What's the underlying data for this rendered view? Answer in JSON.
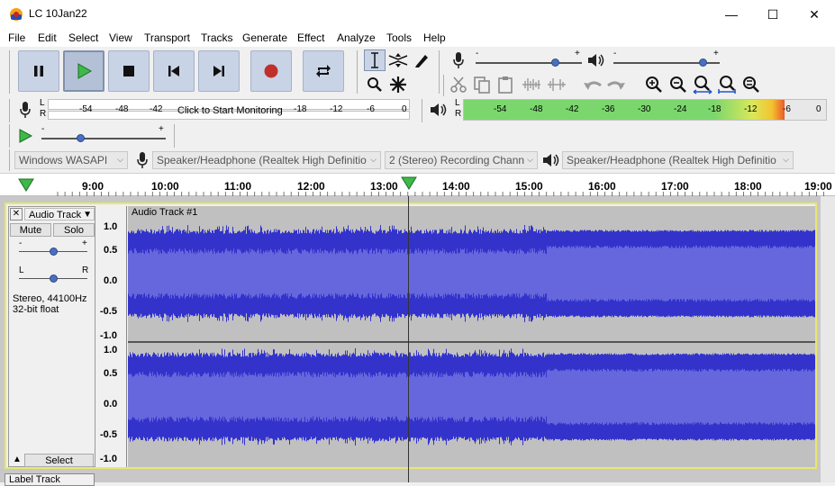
{
  "window": {
    "title": "LC 10Jan22",
    "minimize": "—",
    "maximize": "☐",
    "close": "✕"
  },
  "menu": [
    "File",
    "Edit",
    "Select",
    "View",
    "Transport",
    "Tracks",
    "Generate",
    "Effect",
    "Analyze",
    "Tools",
    "Help"
  ],
  "recording_meter": {
    "channels": [
      "L",
      "R"
    ],
    "ticks": [
      "-54",
      "-48",
      "-42",
      "-18",
      "-12",
      "-6",
      "0"
    ],
    "prompt": "Click to Start Monitoring"
  },
  "playback_meter": {
    "channels": [
      "L",
      "R"
    ],
    "ticks": [
      "-54",
      "-48",
      "-42",
      "-36",
      "-30",
      "-24",
      "-18",
      "-12",
      "-6",
      "0"
    ],
    "level_fraction": 0.885
  },
  "recording_volume": {
    "minus": "-",
    "plus": "+",
    "value": 0.75
  },
  "playback_volume": {
    "minus": "-",
    "plus": "+",
    "value": 0.85
  },
  "play_at_speed": {
    "minus": "-",
    "plus": "+",
    "value": 0.32
  },
  "device": {
    "host": "Windows WASAPI",
    "recording_device": "Speaker/Headphone (Realtek High Definitio",
    "channels": "2 (Stereo) Recording Chann",
    "playback_device": "Speaker/Headphone (Realtek High Definitio"
  },
  "timeline": {
    "labels": [
      "9:00",
      "10:00",
      "11:00",
      "12:00",
      "13:00",
      "14:00",
      "15:00",
      "16:00",
      "17:00",
      "18:00",
      "19:00"
    ]
  },
  "track": {
    "name": "Audio Track",
    "clip_name": "Audio Track #1",
    "mute": "Mute",
    "solo": "Solo",
    "gain_minus": "-",
    "gain_plus": "+",
    "pan_left": "L",
    "pan_right": "R",
    "format_line1": "Stereo, 44100Hz",
    "format_line2": "32-bit float",
    "select": "Select",
    "close": "✕",
    "scale_top": [
      "1.0",
      "0.5",
      "0.0",
      "-0.5",
      "-1.0"
    ],
    "scale_bottom": [
      "1.0",
      "0.5",
      "0.0",
      "-0.5",
      "-1.0"
    ]
  },
  "next_track": {
    "name": "Label Track"
  },
  "colors": {
    "wave_dark": "#3333cc",
    "wave_light": "#6666dd",
    "wave_bg": "#c0c0c0",
    "selected_border": "#e8e86e",
    "meter_green": "#7bd66e"
  }
}
